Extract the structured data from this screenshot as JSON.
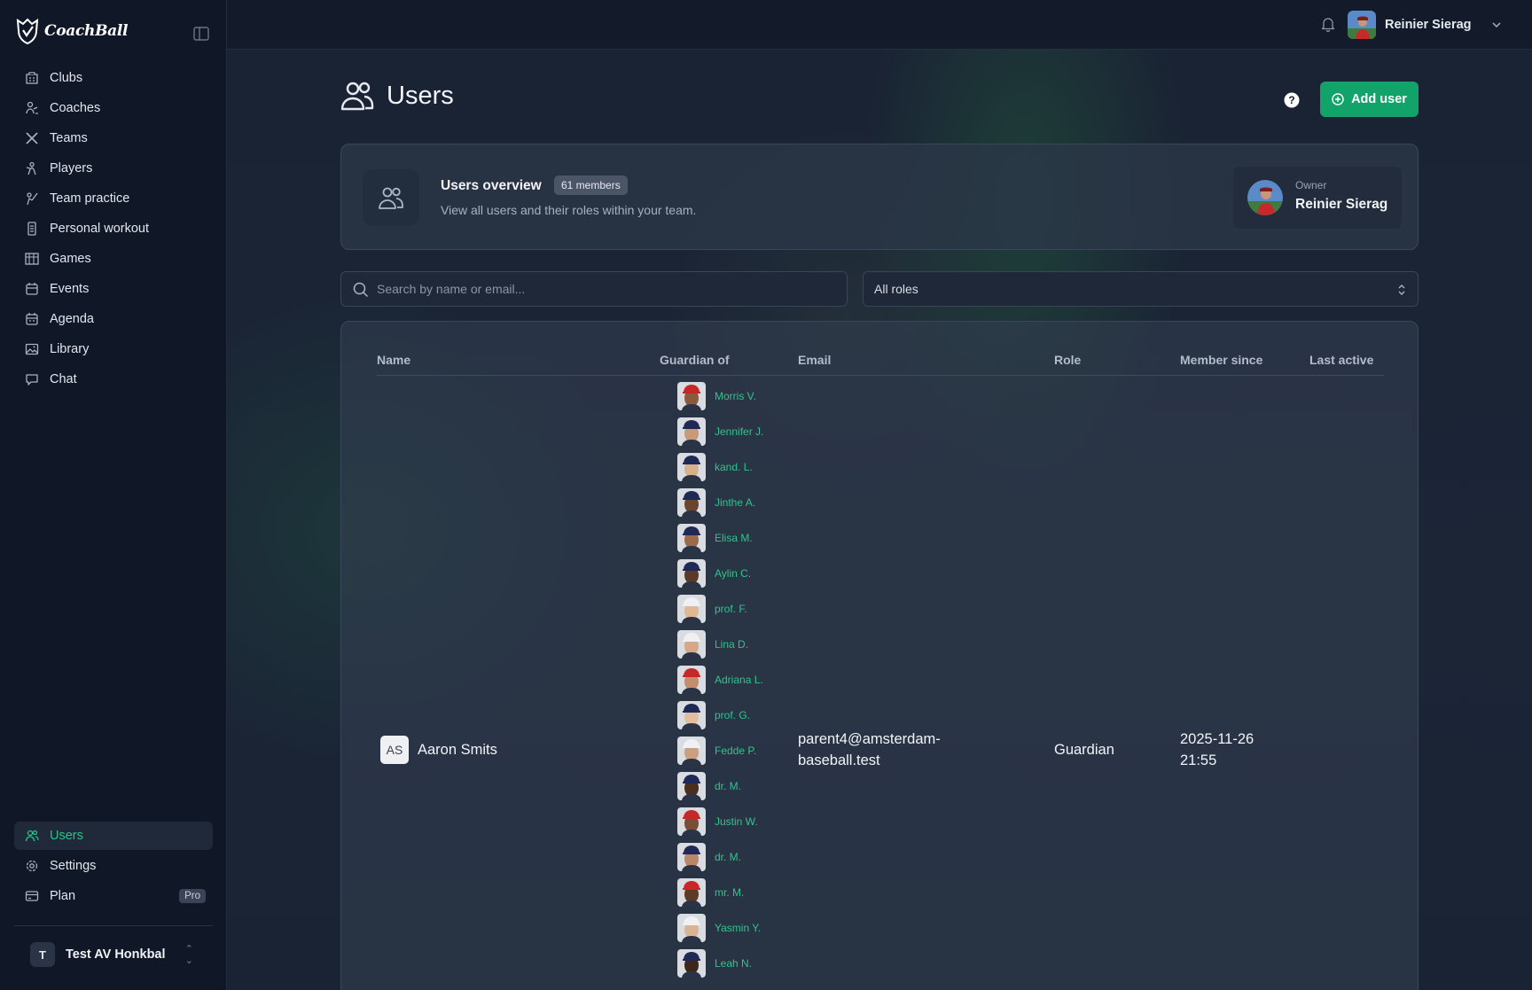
{
  "brand": {
    "name": "CoachBall"
  },
  "sidebar": {
    "items": [
      {
        "label": "Clubs",
        "icon": "building-icon"
      },
      {
        "label": "Coaches",
        "icon": "coach-icon"
      },
      {
        "label": "Teams",
        "icon": "crossed-bats-icon"
      },
      {
        "label": "Players",
        "icon": "player-icon"
      },
      {
        "label": "Team practice",
        "icon": "practice-icon"
      },
      {
        "label": "Personal workout",
        "icon": "workout-icon"
      },
      {
        "label": "Games",
        "icon": "scoreboard-icon"
      },
      {
        "label": "Events",
        "icon": "calendar-icon"
      },
      {
        "label": "Agenda",
        "icon": "agenda-icon"
      },
      {
        "label": "Library",
        "icon": "image-icon"
      },
      {
        "label": "Chat",
        "icon": "chat-icon"
      }
    ],
    "bottom_items": [
      {
        "label": "Users",
        "icon": "users-icon",
        "active": true
      },
      {
        "label": "Settings",
        "icon": "gear-icon"
      },
      {
        "label": "Plan",
        "icon": "card-icon",
        "badge": "Pro"
      }
    ],
    "team": {
      "initial": "T",
      "name": "Test AV Honkbal"
    }
  },
  "topbar": {
    "user_name": "Reinier Sierag"
  },
  "page": {
    "title": "Users",
    "add_button": "Add user",
    "overview": {
      "title": "Users overview",
      "badge": "61 members",
      "description": "View all users and their roles within your team.",
      "owner_label": "Owner",
      "owner_name": "Reinier Sierag"
    },
    "search": {
      "placeholder": "Search by name or email..."
    },
    "role_filter": {
      "value": "All roles"
    }
  },
  "table": {
    "headers": {
      "name": "Name",
      "guardian_of": "Guardian of",
      "email": "Email",
      "role": "Role",
      "member_since": "Member since",
      "last_active": "Last active"
    },
    "rows": [
      {
        "initials": "AS",
        "name": "Aaron Smits",
        "email": "parent4@amsterdam-baseball.test",
        "role": "Guardian",
        "member_since": "2025-11-26 21:55",
        "last_active": "",
        "guardian_of": [
          "Morris V.",
          "Jennifer J.",
          "kand. L.",
          "Jinthe A.",
          "Elisa M.",
          "Aylin C.",
          "prof. F.",
          "Lina D.",
          "Adriana L.",
          "prof. G.",
          "Fedde P.",
          "dr. M.",
          "Justin W.",
          "dr. M.",
          "mr. M.",
          "Yasmin Y.",
          "Leah N."
        ]
      }
    ]
  },
  "colors": {
    "accent": "#22c58b",
    "primary_button": "#12a36a",
    "sidebar_bg": "#101727",
    "main_bg": "#1a2334"
  }
}
